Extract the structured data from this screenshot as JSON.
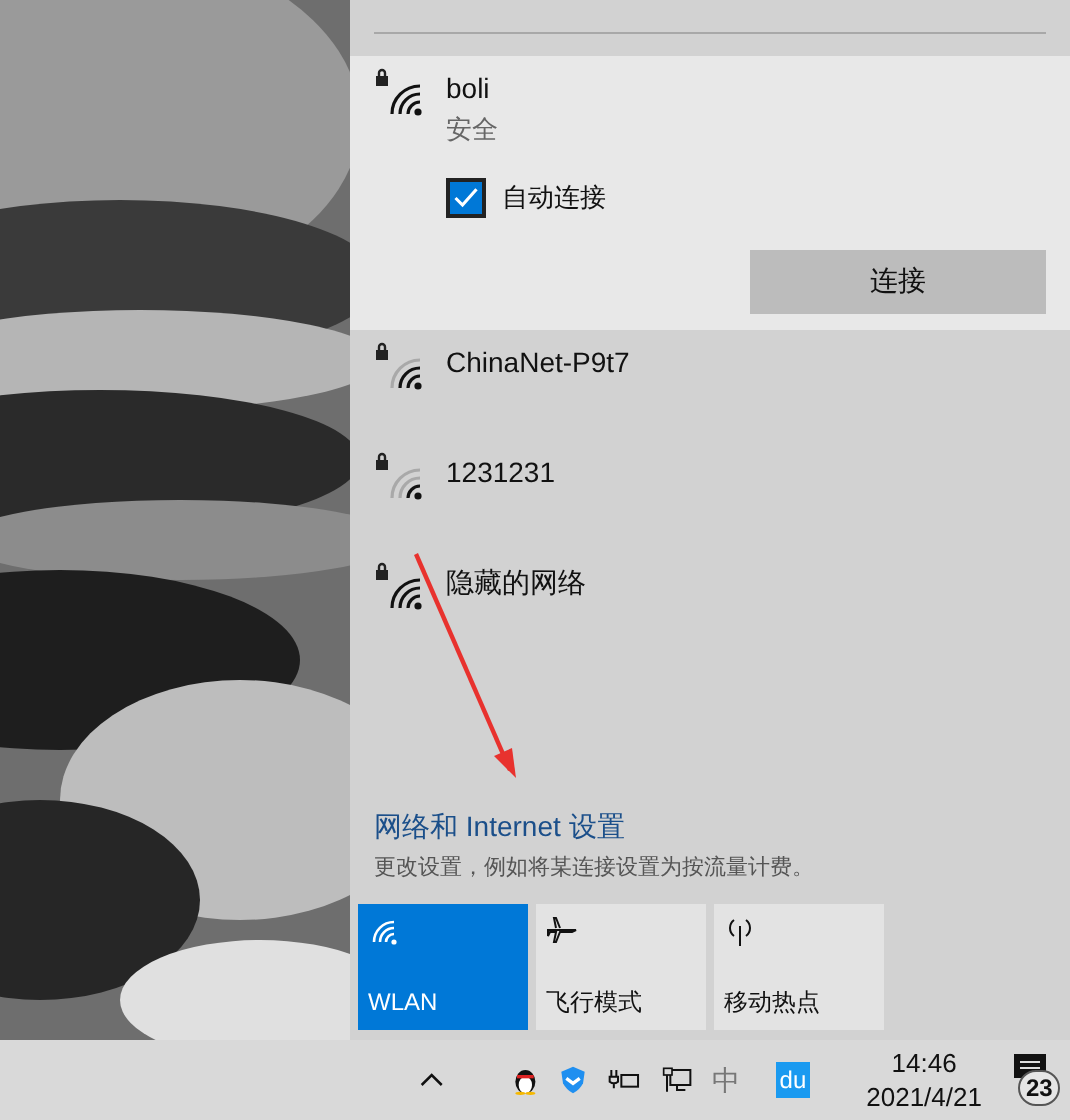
{
  "networks": [
    {
      "name": "boli",
      "status": "安全",
      "kind": "strong",
      "expanded": true,
      "auto_connect": {
        "label": "自动连接",
        "checked": true
      },
      "button": "连接"
    },
    {
      "name": "ChinaNet-P9t7",
      "kind": "medium",
      "expanded": false
    },
    {
      "name": "1231231",
      "kind": "weak",
      "expanded": false
    },
    {
      "name": "隐藏的网络",
      "kind": "strong",
      "expanded": false
    }
  ],
  "settings": {
    "link": "网络和 Internet 设置",
    "description": "更改设置，例如将某连接设置为按流量计费。"
  },
  "quick_actions": [
    {
      "kind": "wifi",
      "label": "WLAN",
      "on": true
    },
    {
      "kind": "airplane",
      "label": "飞行模式",
      "on": false
    },
    {
      "kind": "hotspot",
      "label": "移动热点",
      "on": false
    }
  ],
  "taskbar": {
    "ime": "中",
    "app_label": "du",
    "time": "14:46",
    "date": "2021/4/21",
    "notifications": "23"
  }
}
